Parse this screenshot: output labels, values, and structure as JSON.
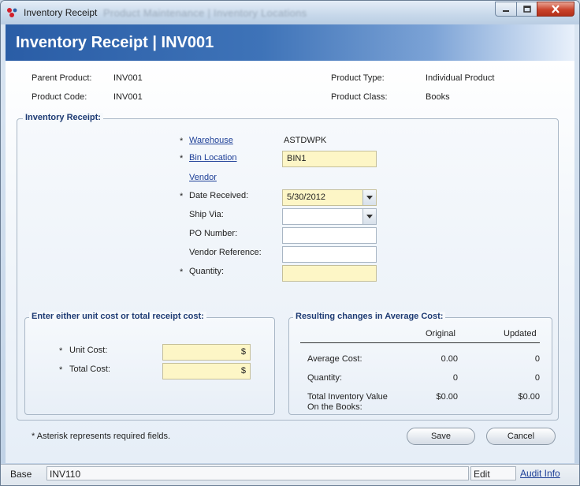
{
  "window": {
    "title": "Inventory Receipt",
    "background_tabs": "Product Maintenance  |  Inventory Locations"
  },
  "header": {
    "title": "Inventory Receipt  |  INV001"
  },
  "product_info": {
    "parent_product_label": "Parent Product:",
    "parent_product_value": "INV001",
    "product_code_label": "Product Code:",
    "product_code_value": "INV001",
    "product_type_label": "Product Type:",
    "product_type_value": "Individual Product",
    "product_class_label": "Product Class:",
    "product_class_value": "Books"
  },
  "receipt": {
    "group_title": "Inventory Receipt:",
    "required_marker": "*",
    "warehouse_label": "Warehouse",
    "warehouse_value": "ASTDWPK",
    "bin_location_label": "Bin Location",
    "bin_location_value": "BIN1",
    "vendor_label": "Vendor",
    "date_received_label": "Date Received:",
    "date_received_value": "5/30/2012",
    "ship_via_label": "Ship Via:",
    "ship_via_value": "",
    "po_number_label": "PO Number:",
    "po_number_value": "",
    "vendor_reference_label": "Vendor Reference:",
    "vendor_reference_value": "",
    "quantity_label": "Quantity:",
    "quantity_value": ""
  },
  "cost": {
    "group_title": "Enter either unit cost or total receipt cost:",
    "unit_cost_label": "Unit Cost:",
    "unit_cost_value": "$",
    "total_cost_label": "Total Cost:",
    "total_cost_value": "$"
  },
  "average_cost": {
    "group_title": "Resulting changes in Average Cost:",
    "col_original": "Original",
    "col_updated": "Updated",
    "rows": [
      {
        "label": "Average Cost:",
        "original": "0.00",
        "updated": "0"
      },
      {
        "label": "Quantity:",
        "original": "0",
        "updated": "0"
      },
      {
        "label": "Total Inventory Value\nOn the Books:",
        "original": "$0.00",
        "updated": "$0.00"
      }
    ]
  },
  "footer": {
    "required_note": "* Asterisk represents required fields.",
    "save_label": "Save",
    "cancel_label": "Cancel"
  },
  "statusbar": {
    "mode": "Base",
    "code": "INV110",
    "state": "Edit",
    "audit_link": "Audit Info"
  },
  "colors": {
    "banner_start": "#2a5da6",
    "link": "#1d3f97",
    "required_field": "#fdf6c6",
    "group_title": "#1d3a73"
  }
}
